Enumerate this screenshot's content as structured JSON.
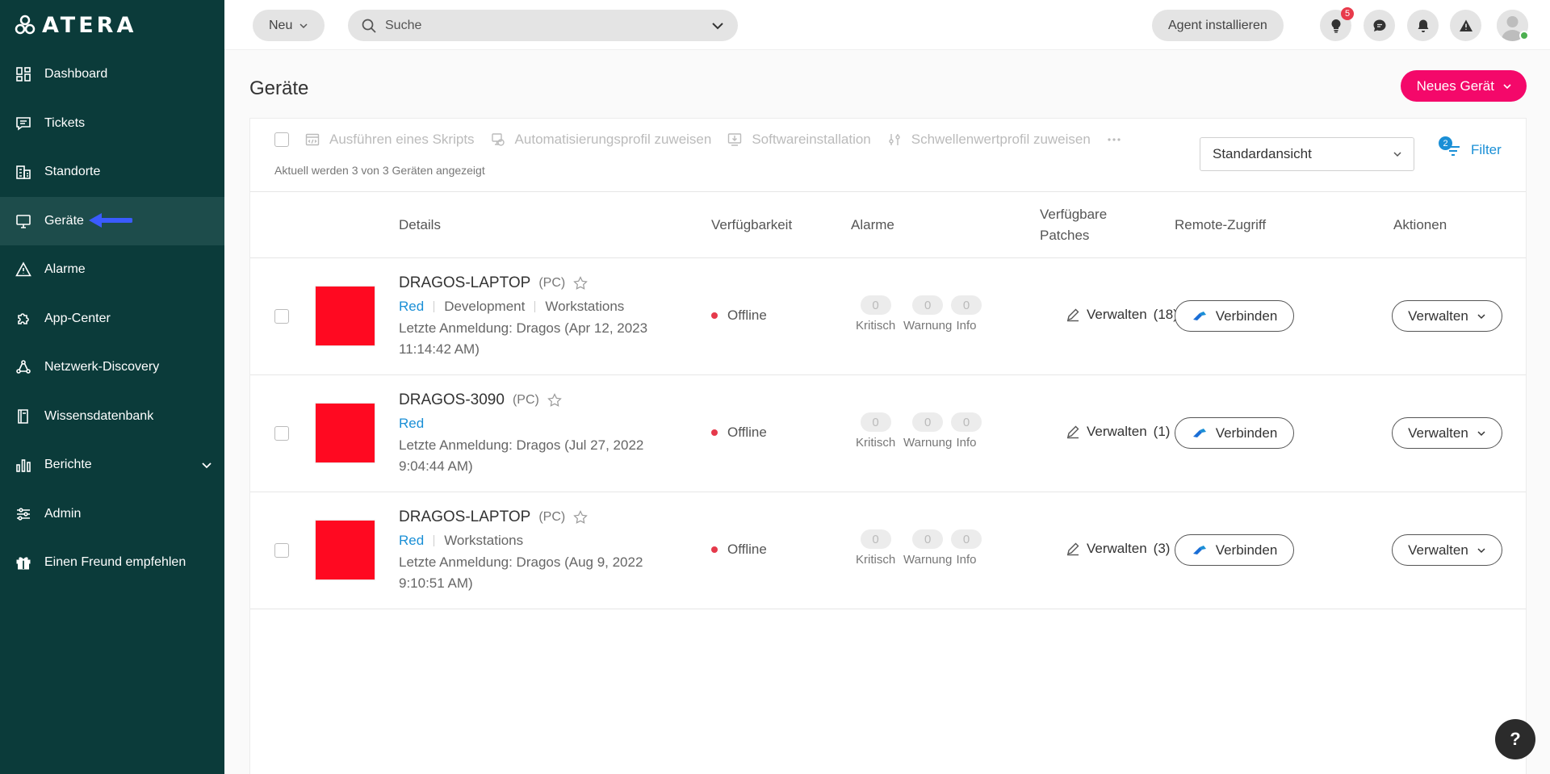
{
  "brand": {
    "name": "ATERA",
    "colors": {
      "sidebar": "#0b3b3a",
      "active": "#1d4c4b",
      "primary": "#f4086a",
      "link": "#1a8fd6",
      "offline": "#e5394b",
      "thumb": "#ff0921"
    }
  },
  "sidebar": {
    "items": [
      {
        "label": "Dashboard",
        "icon": "dashboard-icon"
      },
      {
        "label": "Tickets",
        "icon": "tickets-icon"
      },
      {
        "label": "Standorte",
        "icon": "building-icon"
      },
      {
        "label": "Geräte",
        "icon": "monitor-icon",
        "active": true
      },
      {
        "label": "Alarme",
        "icon": "warning-icon"
      },
      {
        "label": "App-Center",
        "icon": "puzzle-icon"
      },
      {
        "label": "Netzwerk-Discovery",
        "icon": "network-icon"
      },
      {
        "label": "Wissensdatenbank",
        "icon": "book-icon"
      },
      {
        "label": "Berichte",
        "icon": "chart-icon",
        "expandable": true
      },
      {
        "label": "Admin",
        "icon": "sliders-icon"
      },
      {
        "label": "Einen Freund empfehlen",
        "icon": "gift-icon"
      }
    ]
  },
  "topbar": {
    "new_label": "Neu",
    "search_placeholder": "Suche",
    "install_agent_label": "Agent installieren",
    "notifications_badge": "5"
  },
  "main": {
    "title": "Geräte",
    "new_device_label": "Neues Gerät",
    "toolbar": {
      "actions": [
        "Ausführen eines Skripts",
        "Automatisierungsprofil zuweisen",
        "Softwareinstallation",
        "Schwellenwertprofil zuweisen"
      ],
      "count_text": "Aktuell werden 3 von 3 Geräten angezeigt",
      "view_selected": "Standardansicht",
      "filter_label": "Filter",
      "filter_count": "2"
    },
    "columns": {
      "details": "Details",
      "availability": "Verfügbarkeit",
      "alarms": "Alarme",
      "patches_line1": "Verfügbare",
      "patches_line2": "Patches",
      "remote": "Remote-Zugriff",
      "actions": "Aktionen"
    },
    "alarm_labels": {
      "critical": "Kritisch",
      "warning": "Warnung",
      "info": "Info"
    },
    "connect_label": "Verbinden",
    "manage_label": "Verwalten",
    "devices": [
      {
        "name": "DRAGOS-LAPTOP",
        "type": "(PC)",
        "customer": "Red",
        "tags": [
          "Development",
          "Workstations"
        ],
        "last_login": "Letzte Anmeldung: Dragos (Apr 12, 2023 11:14:42 AM)",
        "status": "Offline",
        "alarms": {
          "critical": "0",
          "warning": "0",
          "info": "0"
        },
        "patches_label": "Verwalten",
        "patches_count": "(18)"
      },
      {
        "name": "DRAGOS-3090",
        "type": "(PC)",
        "customer": "Red",
        "tags": [],
        "last_login": "Letzte Anmeldung: Dragos (Jul 27, 2022 9:04:44 AM)",
        "status": "Offline",
        "alarms": {
          "critical": "0",
          "warning": "0",
          "info": "0"
        },
        "patches_label": "Verwalten",
        "patches_count": "(1)"
      },
      {
        "name": "DRAGOS-LAPTOP",
        "type": "(PC)",
        "customer": "Red",
        "tags": [
          "Workstations"
        ],
        "last_login": "Letzte Anmeldung: Dragos (Aug 9, 2022 9:10:51 AM)",
        "status": "Offline",
        "alarms": {
          "critical": "0",
          "warning": "0",
          "info": "0"
        },
        "patches_label": "Verwalten",
        "patches_count": "(3)"
      }
    ]
  },
  "help_label": "?"
}
